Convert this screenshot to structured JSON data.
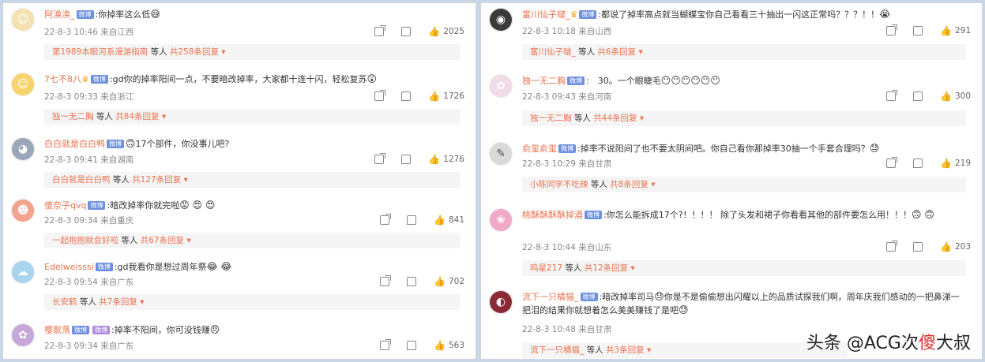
{
  "left_comments": [
    {
      "avatar_color": "#f3e2b0",
      "avatar_glyph": "☺",
      "name": "阿涣涣_",
      "badge": "微博",
      "vip": false,
      "crown": false,
      "text": ":你掉率这么低",
      "emoji": "😅",
      "date": "22-8-3 10:46 来自江西",
      "likes": "2025",
      "reply_name": "第1989本眼河系漫游指南",
      "reply_text": " 等人 ",
      "reply_count": "共258条回复 ▾"
    },
    {
      "avatar_color": "#f6d36b",
      "avatar_glyph": "☺",
      "name": "7七不8八",
      "badge": "微博",
      "vip": false,
      "crown": true,
      "text": ":gd你的掉率阳间一点，不要暗改掉率，大家都十连十闪，轻松复苏",
      "emoji": "😲",
      "date": "22-8-3 09:33 来自浙江",
      "likes": "1726",
      "reply_name": "独一无二胸",
      "reply_text": " 等人 ",
      "reply_count": "共84条回复 ▾"
    },
    {
      "avatar_color": "#9aa7b8",
      "avatar_glyph": "◕",
      "name": "白白就是白白鸭",
      "badge": "微博",
      "vip": false,
      "crown": false,
      "text": "17个部件，你没事儿吧?",
      "emoji": "🙃",
      "date": "22-8-3 09:41 来自湖南",
      "likes": "1276",
      "reply_name": "白白就是白白鸭",
      "reply_text": " 等人 ",
      "reply_count": "共127条回复 ▾"
    },
    {
      "avatar_color": "#f2a48e",
      "avatar_glyph": "☻",
      "name": "傻奈子qvq",
      "badge": "微博",
      "vip": false,
      "crown": false,
      "text": ":暗改掉率你就完啦",
      "emoji": "😡 😍 😍",
      "date": "22-8-3 09:34 来自重庆",
      "likes": "841",
      "reply_name": "一起抱抱就会好啦",
      "reply_text": " 等人 ",
      "reply_count": "共67条回复 ▾"
    },
    {
      "avatar_color": "#a9d4ee",
      "avatar_glyph": "☁",
      "name": "Edelweisssi",
      "badge": "微博",
      "vip": false,
      "crown": false,
      "text": ":gd我看你是想过周年祭",
      "emoji": "😂 😂",
      "date": "22-8-3 09:54 来自广东",
      "likes": "702",
      "reply_name": "长安鹤",
      "reply_text": " 等人 ",
      "reply_count": "共7条回复 ▾"
    },
    {
      "avatar_color": "#c5a8d8",
      "avatar_glyph": "✿",
      "name": "樱歌落",
      "badge": "微博",
      "vip": true,
      "crown": false,
      "text": ":掉率不阳间，你可没钱赚",
      "emoji": "😠",
      "date": "22-8-3 09:34 来自广东",
      "likes": "563",
      "reply_name": "",
      "reply_text": "",
      "reply_count": ""
    }
  ],
  "right_comments": [
    {
      "avatar_color": "#3a3a3a",
      "avatar_glyph": "◉",
      "name": "富川仙子啵_",
      "badge": "微博",
      "vip": false,
      "crown": true,
      "text": ":都说了掉率高点就当蝴蝶宝你自己看看三十抽出一闪这正常吗？？？！！",
      "emoji": "😭",
      "date": "22-8-3 10:18 来自山西",
      "likes": "291",
      "reply_name": "富川仙子啵_",
      "reply_text": " 等人 ",
      "reply_count": "共6条回复 ▾"
    },
    {
      "avatar_color": "#f1dbe6",
      "avatar_glyph": "✿",
      "name": "独一无二胸",
      "badge": "微博",
      "vip": false,
      "crown": false,
      "text": ":　30。一个眼睫毛",
      "emoji": "😶😶😶😶😶😶",
      "date": "22-8-3 09:43 来自河南",
      "likes": "300",
      "reply_name": "独一无二胸",
      "reply_text": " 等人 ",
      "reply_count": "共44条回复 ▾"
    },
    {
      "avatar_color": "#d9d9d9",
      "avatar_glyph": "✎",
      "name": "俞玺俞玺",
      "badge": "微博",
      "vip": false,
      "crown": false,
      "text": ":掉率不说阳间了也不要太阴间吧。你自己看你那掉率30抽一个手套合理吗？",
      "emoji": "😓",
      "date": "22-8-3 10:29 来自甘肃",
      "likes": "219",
      "reply_name": "小陈同学不吃辣",
      "reply_text": " 等人 ",
      "reply_count": "共8条回复 ▾"
    },
    {
      "avatar_color": "#f0a9c4",
      "avatar_glyph": "❀",
      "name": "桃酥酥酥酥掉酒",
      "badge": "微博",
      "vip": false,
      "crown": false,
      "text": ":你怎么能拆成17个?！！！！ 除了头发和裙子你看看其他的部件要怎么用！！！",
      "emoji": "🙃 🙃",
      "date": "22-8-3 10:44 来自山东",
      "likes": "203",
      "reply_name": "鸣星217",
      "reply_text": " 等人 ",
      "reply_count": "共12条回复 ▾"
    },
    {
      "avatar_color": "#8a2a35",
      "avatar_glyph": "◐",
      "name": "流下一只橘猫_",
      "badge": "微博",
      "vip": false,
      "crown": false,
      "text": ":暗改掉率司马",
      "text2": "你是不是偷偷想出闪耀以上的品质试探我们啊，周年庆我们感动的一把鼻涕一把泪的结果你就想着怎么美美赚钱了是吧",
      "emoji": "😓",
      "emoji_end": "😓",
      "date": "22-8-3 10:48 来自甘肃",
      "likes": "",
      "reply_name": "流下一只橘猫_",
      "reply_text": " 等人 ",
      "reply_count": "共3条回复 ▾"
    }
  ],
  "icons": {
    "share": "share-icon",
    "reply": "comment-icon",
    "like": "thumbs-up-icon"
  },
  "watermark": {
    "prefix": "头条 @ACG次",
    "highlight": "傻",
    "suffix": "大叔"
  }
}
